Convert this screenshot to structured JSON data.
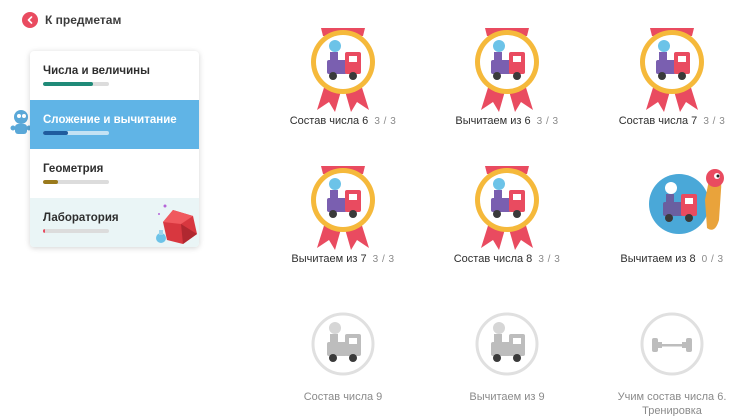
{
  "back_link": {
    "label": "К предметам",
    "icon": "chevron-left-icon",
    "color": "#e94b60"
  },
  "sidebar": {
    "items": [
      {
        "label": "Числа и величины",
        "progress": 0.75,
        "color": "#1f8a78",
        "active": false
      },
      {
        "label": "Сложение и вычитание",
        "progress": 0.38,
        "color": "#1f5c9e",
        "active": true
      },
      {
        "label": "Геометрия",
        "progress": 0.22,
        "color": "#9a7a1c",
        "active": false
      },
      {
        "label": "Лаборатория",
        "progress": 0.03,
        "color": "#e94b60",
        "active": false
      }
    ]
  },
  "lessons": [
    {
      "title": "Состав числа 6",
      "score": "3 / 3",
      "state": "completed"
    },
    {
      "title": "Вычитаем из 6",
      "score": "3 / 3",
      "state": "completed"
    },
    {
      "title": "Состав числа 7",
      "score": "3 / 3",
      "state": "completed"
    },
    {
      "title": "Вычитаем из 7",
      "score": "3 / 3",
      "state": "completed"
    },
    {
      "title": "Состав числа 8",
      "score": "3 / 3",
      "state": "completed"
    },
    {
      "title": "Вычитаем из 8",
      "score": "0 / 3",
      "state": "current"
    },
    {
      "title": "Состав числа 9",
      "score": "",
      "state": "locked"
    },
    {
      "title": "Вычитаем из 9",
      "score": "",
      "state": "locked"
    },
    {
      "title": "Учим состав числа 6. Тренировка",
      "score": "",
      "state": "locked",
      "icon": "dumbbell-icon"
    }
  ]
}
